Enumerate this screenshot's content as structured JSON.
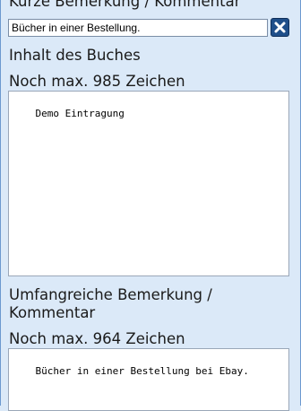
{
  "short_comment": {
    "heading": "Kurze Bemerkung / Kommentar",
    "value": "Bücher in einer Bestellung."
  },
  "book_content": {
    "heading": "Inhalt des Buches",
    "chars_remaining": "Noch max. 985 Zeichen",
    "value": "Demo Eintragung"
  },
  "long_comment": {
    "heading_line1": "Umfangreiche Bemerkung /",
    "heading_line2": "Kommentar",
    "chars_remaining": "Noch max. 964 Zeichen",
    "value": "Bücher in einer Bestellung bei Ebay."
  },
  "icons": {
    "clear": "close-icon",
    "resize": "resize-grip-icon"
  },
  "colors": {
    "background": "#dbe9f8",
    "clear_button": "#1f4f8a"
  }
}
